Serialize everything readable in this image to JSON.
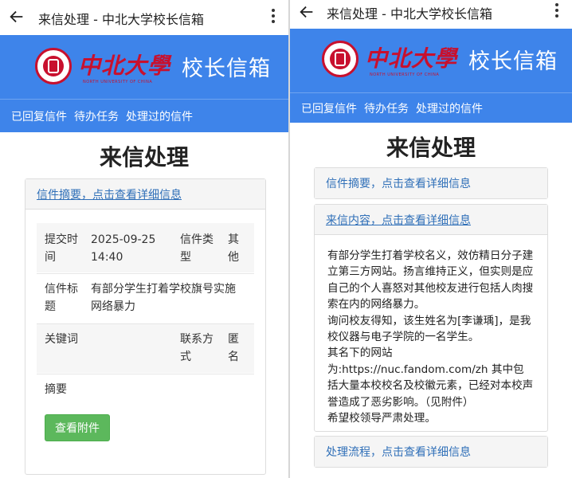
{
  "topbar": {
    "title": "来信处理 - 中北大学校长信箱"
  },
  "banner": {
    "logo_text": "中北大學",
    "logo_subtext": "NORTH UNIVERSITY OF CHINA",
    "mailbox_title": "校长信箱"
  },
  "nav": {
    "items": [
      "已回复信件",
      "待办任务",
      "处理过的信件"
    ]
  },
  "page": {
    "title": "来信处理"
  },
  "summary_panel": {
    "header_link": "信件摘要，点击查看详细信息"
  },
  "content_panel": {
    "header_link": "来信内容，点击查看详细信息"
  },
  "process_panel": {
    "header_link": "处理流程，点击查看详细信息"
  },
  "details": {
    "submit_time_label": "提交时间",
    "submit_time_value": "2025-09-25 14:40",
    "type_label": "信件类型",
    "type_value": "其他",
    "subject_label": "信件标题",
    "subject_value": "有部分学生打着学校旗号实施网络暴力",
    "keyword_label": "关键词",
    "keyword_value": "",
    "contact_label": "联系方式",
    "contact_value": "匿名",
    "abstract_label": "摘要",
    "abstract_value": "",
    "attachment_button": "查看附件"
  },
  "letter": {
    "paragraphs": [
      "有部分学生打着学校名义，效仿精日分子建立第三方网站。扬言维持正义，但实则是应自己的个人喜怒对其他校友进行包括人肉搜索在内的网络暴力。",
      "询问校友得知，该生姓名为[李谦瑀]，是我校仪器与电子学院的一名学生。",
      "其名下的网站为:https://nuc.fandom.com/zh 其中包括大量本校校名及校徽元素，已经对本校声誉造成了恶劣影响。（见附件）",
      "希望校领导严肃处理。"
    ]
  }
}
